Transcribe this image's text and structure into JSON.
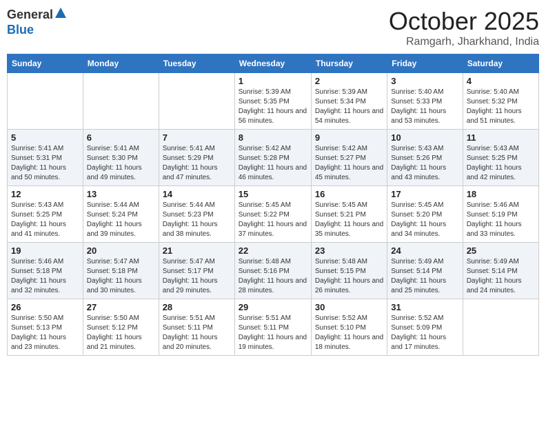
{
  "header": {
    "logo_general": "General",
    "logo_blue": "Blue",
    "month_title": "October 2025",
    "location": "Ramgarh, Jharkhand, India"
  },
  "weekdays": [
    "Sunday",
    "Monday",
    "Tuesday",
    "Wednesday",
    "Thursday",
    "Friday",
    "Saturday"
  ],
  "weeks": [
    [
      {
        "day": "",
        "text": ""
      },
      {
        "day": "",
        "text": ""
      },
      {
        "day": "",
        "text": ""
      },
      {
        "day": "1",
        "text": "Sunrise: 5:39 AM\nSunset: 5:35 PM\nDaylight: 11 hours and 56 minutes."
      },
      {
        "day": "2",
        "text": "Sunrise: 5:39 AM\nSunset: 5:34 PM\nDaylight: 11 hours and 54 minutes."
      },
      {
        "day": "3",
        "text": "Sunrise: 5:40 AM\nSunset: 5:33 PM\nDaylight: 11 hours and 53 minutes."
      },
      {
        "day": "4",
        "text": "Sunrise: 5:40 AM\nSunset: 5:32 PM\nDaylight: 11 hours and 51 minutes."
      }
    ],
    [
      {
        "day": "5",
        "text": "Sunrise: 5:41 AM\nSunset: 5:31 PM\nDaylight: 11 hours and 50 minutes."
      },
      {
        "day": "6",
        "text": "Sunrise: 5:41 AM\nSunset: 5:30 PM\nDaylight: 11 hours and 49 minutes."
      },
      {
        "day": "7",
        "text": "Sunrise: 5:41 AM\nSunset: 5:29 PM\nDaylight: 11 hours and 47 minutes."
      },
      {
        "day": "8",
        "text": "Sunrise: 5:42 AM\nSunset: 5:28 PM\nDaylight: 11 hours and 46 minutes."
      },
      {
        "day": "9",
        "text": "Sunrise: 5:42 AM\nSunset: 5:27 PM\nDaylight: 11 hours and 45 minutes."
      },
      {
        "day": "10",
        "text": "Sunrise: 5:43 AM\nSunset: 5:26 PM\nDaylight: 11 hours and 43 minutes."
      },
      {
        "day": "11",
        "text": "Sunrise: 5:43 AM\nSunset: 5:25 PM\nDaylight: 11 hours and 42 minutes."
      }
    ],
    [
      {
        "day": "12",
        "text": "Sunrise: 5:43 AM\nSunset: 5:25 PM\nDaylight: 11 hours and 41 minutes."
      },
      {
        "day": "13",
        "text": "Sunrise: 5:44 AM\nSunset: 5:24 PM\nDaylight: 11 hours and 39 minutes."
      },
      {
        "day": "14",
        "text": "Sunrise: 5:44 AM\nSunset: 5:23 PM\nDaylight: 11 hours and 38 minutes."
      },
      {
        "day": "15",
        "text": "Sunrise: 5:45 AM\nSunset: 5:22 PM\nDaylight: 11 hours and 37 minutes."
      },
      {
        "day": "16",
        "text": "Sunrise: 5:45 AM\nSunset: 5:21 PM\nDaylight: 11 hours and 35 minutes."
      },
      {
        "day": "17",
        "text": "Sunrise: 5:45 AM\nSunset: 5:20 PM\nDaylight: 11 hours and 34 minutes."
      },
      {
        "day": "18",
        "text": "Sunrise: 5:46 AM\nSunset: 5:19 PM\nDaylight: 11 hours and 33 minutes."
      }
    ],
    [
      {
        "day": "19",
        "text": "Sunrise: 5:46 AM\nSunset: 5:18 PM\nDaylight: 11 hours and 32 minutes."
      },
      {
        "day": "20",
        "text": "Sunrise: 5:47 AM\nSunset: 5:18 PM\nDaylight: 11 hours and 30 minutes."
      },
      {
        "day": "21",
        "text": "Sunrise: 5:47 AM\nSunset: 5:17 PM\nDaylight: 11 hours and 29 minutes."
      },
      {
        "day": "22",
        "text": "Sunrise: 5:48 AM\nSunset: 5:16 PM\nDaylight: 11 hours and 28 minutes."
      },
      {
        "day": "23",
        "text": "Sunrise: 5:48 AM\nSunset: 5:15 PM\nDaylight: 11 hours and 26 minutes."
      },
      {
        "day": "24",
        "text": "Sunrise: 5:49 AM\nSunset: 5:14 PM\nDaylight: 11 hours and 25 minutes."
      },
      {
        "day": "25",
        "text": "Sunrise: 5:49 AM\nSunset: 5:14 PM\nDaylight: 11 hours and 24 minutes."
      }
    ],
    [
      {
        "day": "26",
        "text": "Sunrise: 5:50 AM\nSunset: 5:13 PM\nDaylight: 11 hours and 23 minutes."
      },
      {
        "day": "27",
        "text": "Sunrise: 5:50 AM\nSunset: 5:12 PM\nDaylight: 11 hours and 21 minutes."
      },
      {
        "day": "28",
        "text": "Sunrise: 5:51 AM\nSunset: 5:11 PM\nDaylight: 11 hours and 20 minutes."
      },
      {
        "day": "29",
        "text": "Sunrise: 5:51 AM\nSunset: 5:11 PM\nDaylight: 11 hours and 19 minutes."
      },
      {
        "day": "30",
        "text": "Sunrise: 5:52 AM\nSunset: 5:10 PM\nDaylight: 11 hours and 18 minutes."
      },
      {
        "day": "31",
        "text": "Sunrise: 5:52 AM\nSunset: 5:09 PM\nDaylight: 11 hours and 17 minutes."
      },
      {
        "day": "",
        "text": ""
      }
    ]
  ]
}
